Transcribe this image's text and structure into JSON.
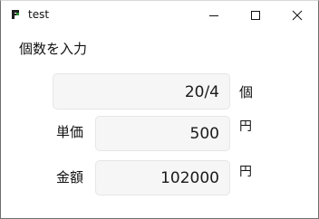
{
  "window": {
    "title": "test",
    "controls": {
      "minimize_icon": "minimize-icon",
      "maximize_icon": "maximize-icon",
      "close_icon": "close-icon"
    }
  },
  "form": {
    "prompt": "個数を入力",
    "quantity": {
      "value": "20/4",
      "unit": "個"
    },
    "unit_price": {
      "label": "単価",
      "value": "500",
      "unit": "円"
    },
    "total": {
      "label": "金額",
      "value": "102000",
      "unit": "円"
    }
  },
  "colors": {
    "field_bg": "#f6f6f6",
    "field_border": "#e6e6e6",
    "icon_green": "#2e8b2e"
  }
}
